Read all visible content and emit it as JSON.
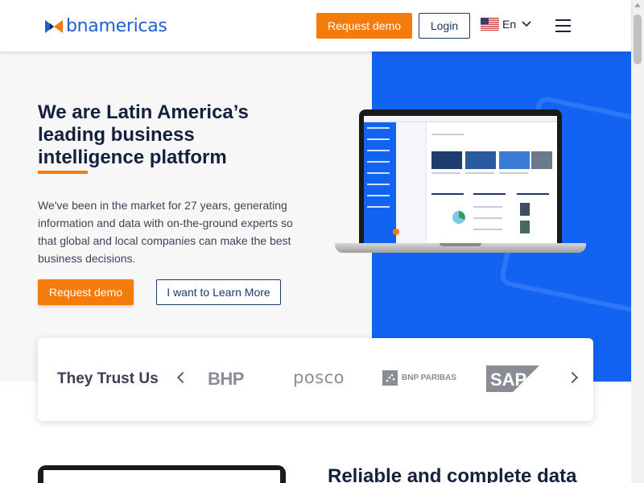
{
  "header": {
    "logo_text": "bnamericas",
    "request_demo_label": "Request demo",
    "login_label": "Login",
    "language": "En"
  },
  "hero": {
    "title_line1": "We are Latin America’s",
    "title_line2": "leading business",
    "title_line3": "intelligence platform",
    "description": "We've been in the market for 27 years, generating information and data with on-the-ground experts so that global and local companies can make the best business decisions.",
    "request_demo_label": "Request demo",
    "learn_more_label": "I want to Learn More"
  },
  "trust": {
    "title": "They Trust Us",
    "brands": [
      "BHP",
      "posco",
      "BNP PARIBAS",
      "SAP"
    ]
  },
  "bottom": {
    "title": "Reliable and complete data"
  },
  "colors": {
    "accent_orange": "#f57c0a",
    "brand_blue": "#1363f2",
    "navy": "#1b3a6b"
  }
}
